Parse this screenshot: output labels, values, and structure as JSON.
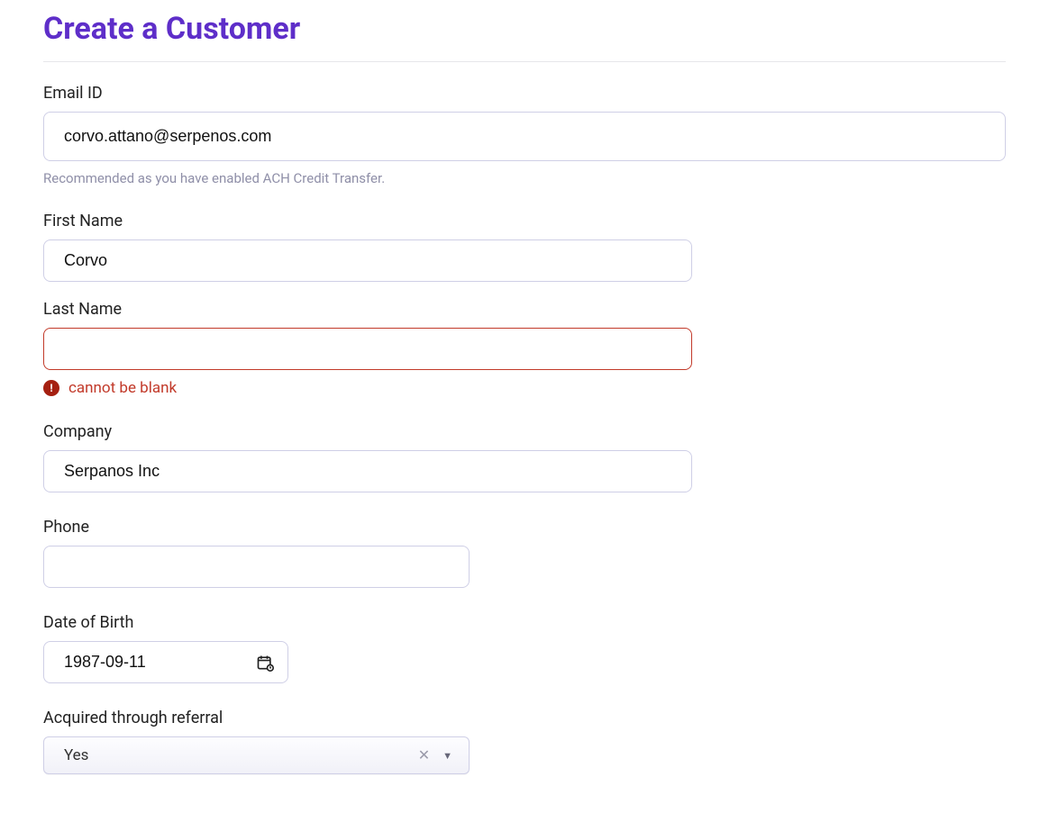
{
  "page": {
    "title": "Create a Customer"
  },
  "fields": {
    "email": {
      "label": "Email ID",
      "value": "corvo.attano@serpenos.com",
      "helper": "Recommended as you have enabled ACH Credit Transfer."
    },
    "firstName": {
      "label": "First Name",
      "value": "Corvo"
    },
    "lastName": {
      "label": "Last Name",
      "value": "",
      "error": "cannot be blank"
    },
    "company": {
      "label": "Company",
      "value": "Serpanos Inc"
    },
    "phone": {
      "label": "Phone",
      "value": ""
    },
    "dob": {
      "label": "Date of Birth",
      "value": "1987-09-11"
    },
    "referral": {
      "label": "Acquired through referral",
      "value": "Yes"
    }
  }
}
